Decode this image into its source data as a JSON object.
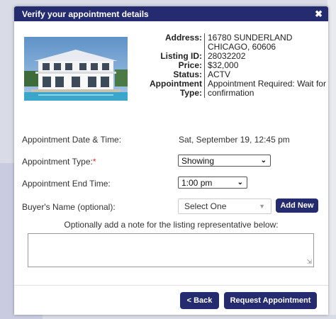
{
  "dialog": {
    "title": "Verify your appointment details",
    "close_glyph": "✖"
  },
  "listing": {
    "address_label": "Address:",
    "address_line1": "16780 SUNDERLAND",
    "address_line2": "CHICAGO, 60606",
    "listing_id_label": "Listing ID:",
    "listing_id": "28032202",
    "price_label": "Price:",
    "price": "$32,000",
    "status_label": "Status:",
    "status": "ACTV",
    "appt_type_label_1": "Appointment",
    "appt_type_label_2": "Type:",
    "appt_type_line1": "Appointment Required: Wait for",
    "appt_type_line2": "confirmation"
  },
  "form": {
    "date_time_label": "Appointment Date & Time:",
    "date_time_value": "Sat, September 19, 12:45 pm",
    "type_label": "Appointment Type:",
    "required_mark": "*",
    "type_value": "Showing",
    "end_time_label": "Appointment End Time:",
    "end_time_value": "1:00 pm",
    "buyer_label": "Buyer's Name (optional):",
    "buyer_value": "Select One",
    "add_new_label": "Add New",
    "note_label": "Optionally add a note for the listing representative below:",
    "note_value": ""
  },
  "footer": {
    "back_label": "< Back",
    "request_label": "Request Appointment"
  },
  "colors": {
    "primary": "#252b6f",
    "required": "#d62a2a"
  }
}
